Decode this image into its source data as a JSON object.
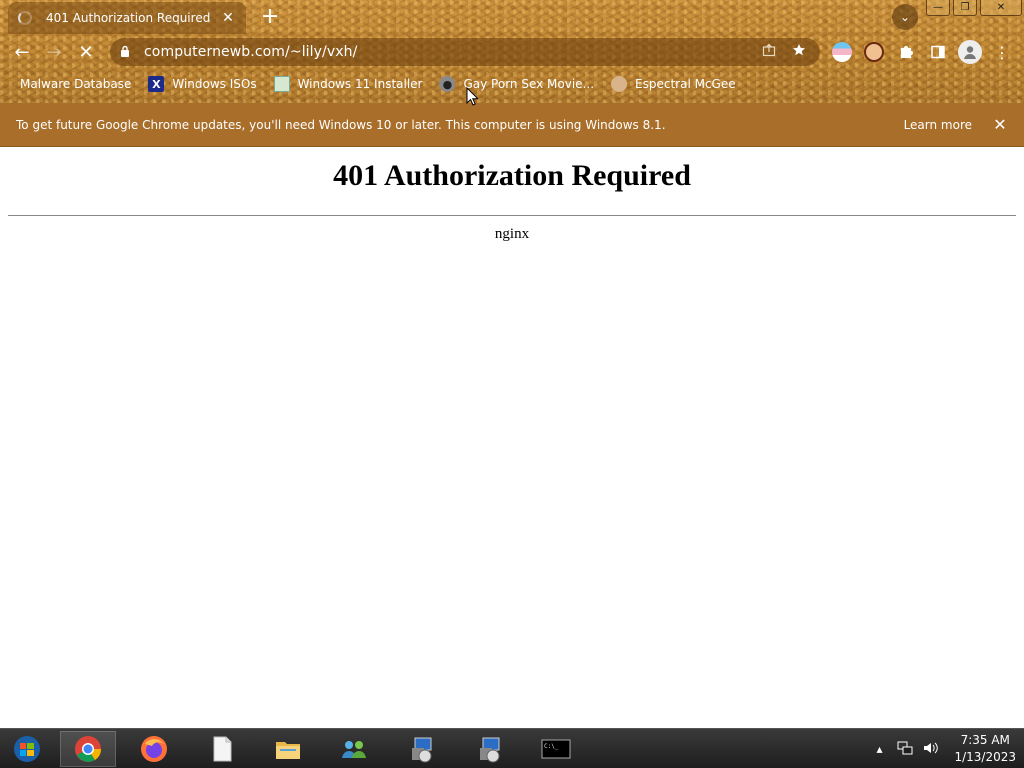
{
  "tab": {
    "title": "401 Authorization Required",
    "close": "✕"
  },
  "toolbar": {
    "new_tab": "+",
    "tab_search": "⌄",
    "back": "←",
    "forward": "→",
    "reload": "✕",
    "url": "computernewb.com/~lily/vxh/"
  },
  "window_controls": {
    "minimize": "—",
    "maximize": "❐",
    "close": "✕"
  },
  "bookmarks": [
    {
      "label": "Malware Database",
      "icon": "none"
    },
    {
      "label": "Windows ISOs",
      "icon": "x-icon"
    },
    {
      "label": "Windows 11 Installer",
      "icon": "image-icon"
    },
    {
      "label": "Gay Porn Sex Movie...",
      "icon": "disk-icon"
    },
    {
      "label": "Espectral McGee",
      "icon": "face-icon"
    }
  ],
  "infobar": {
    "message": "To get future Google Chrome updates, you'll need Windows 10 or later. This computer is using Windows 8.1.",
    "learn_more": "Learn more",
    "close": "✕"
  },
  "page": {
    "heading": "401 Authorization Required",
    "server": "nginx"
  },
  "taskbar": {
    "time": "7:35 AM",
    "date": "1/13/2023"
  },
  "colors": {
    "frame": "#b9802f",
    "infobar": "#a86e2a",
    "taskbar": "#1e1e1e"
  }
}
